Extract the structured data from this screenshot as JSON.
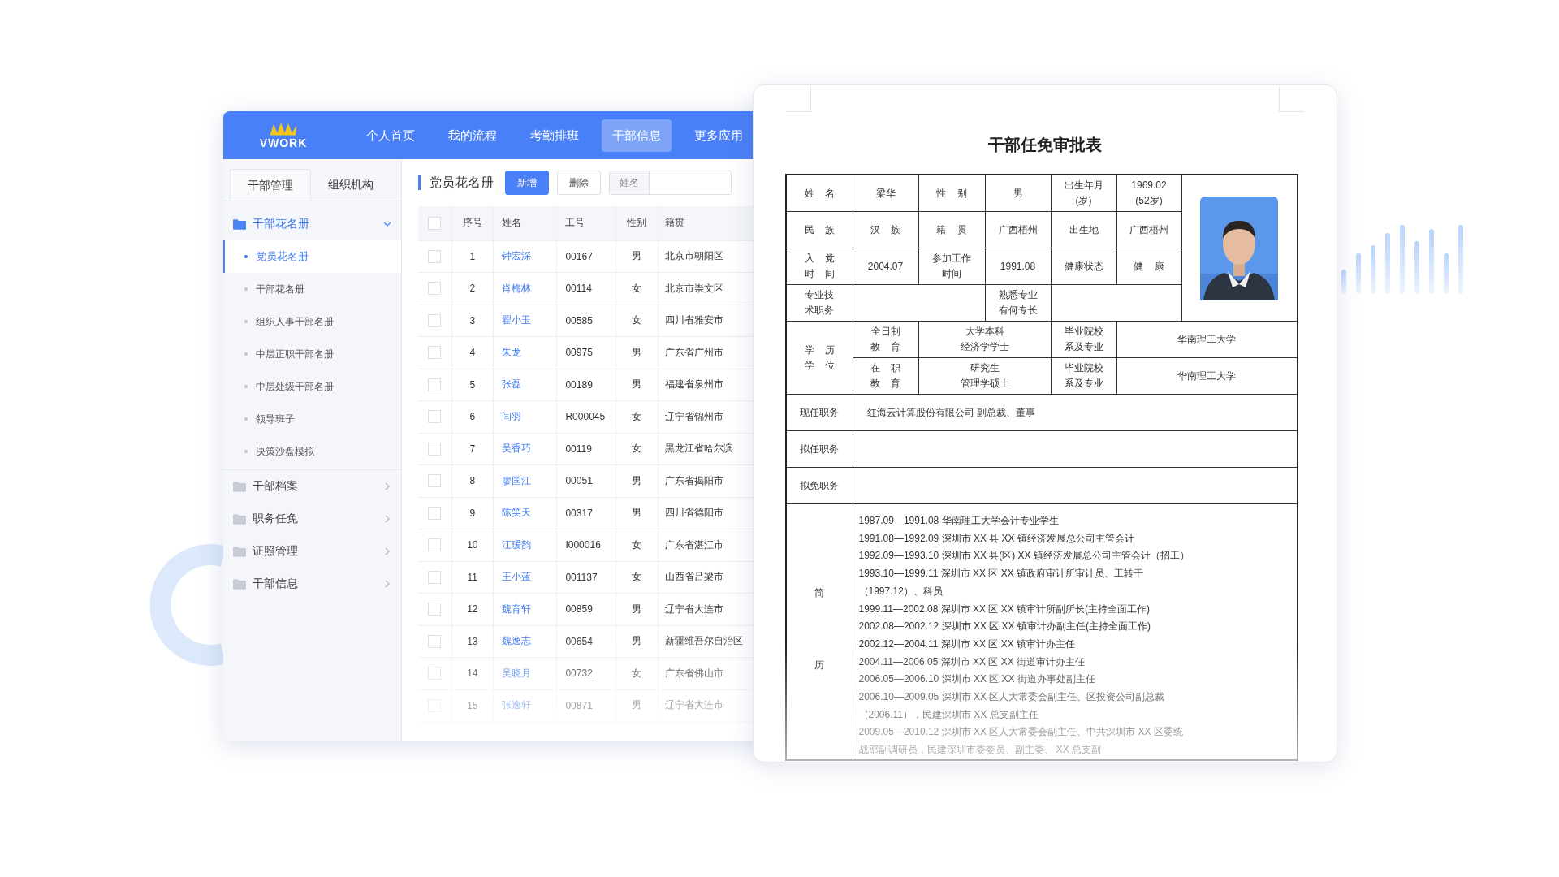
{
  "nav": {
    "logo": "VWORK",
    "items": [
      {
        "label": "个人首页",
        "selected": false
      },
      {
        "label": "我的流程",
        "selected": false
      },
      {
        "label": "考勤排班",
        "selected": false
      },
      {
        "label": "干部信息",
        "selected": true
      },
      {
        "label": "更多应用",
        "selected": false
      }
    ]
  },
  "sidebar": {
    "tabs": [
      {
        "label": "干部管理",
        "selected": true
      },
      {
        "label": "组织机构",
        "selected": false
      }
    ],
    "groups": [
      {
        "label": "干部花名册",
        "expanded": true,
        "children": [
          {
            "label": "党员花名册",
            "selected": true
          },
          {
            "label": "干部花名册",
            "selected": false
          },
          {
            "label": "组织人事干部名册",
            "selected": false
          },
          {
            "label": "中层正职干部名册",
            "selected": false
          },
          {
            "label": "中层处级干部名册",
            "selected": false
          },
          {
            "label": "领导班子",
            "selected": false
          },
          {
            "label": "决策沙盘模拟",
            "selected": false
          }
        ]
      },
      {
        "label": "干部档案",
        "expanded": false
      },
      {
        "label": "职务任免",
        "expanded": false
      },
      {
        "label": "证照管理",
        "expanded": false
      },
      {
        "label": "干部信息",
        "expanded": false
      }
    ]
  },
  "roster": {
    "title": "党员花名册",
    "buttons": [
      {
        "label": "新增",
        "kind": "primary"
      },
      {
        "label": "删除",
        "kind": "default"
      }
    ],
    "search": {
      "label": "姓名"
    },
    "all_checked": false,
    "columns": [
      "序号",
      "姓名",
      "工号",
      "性别",
      "籍贯"
    ],
    "rows": [
      {
        "checked": false,
        "cells": [
          "1",
          "钟宏深",
          "00167",
          "男",
          "北京市朝阳区"
        ]
      },
      {
        "checked": false,
        "cells": [
          "2",
          "肖梅林",
          "00114",
          "女",
          "北京市崇文区"
        ]
      },
      {
        "checked": false,
        "cells": [
          "3",
          "翟小玉",
          "00585",
          "女",
          "四川省雅安市"
        ]
      },
      {
        "checked": false,
        "cells": [
          "4",
          "朱龙",
          "00975",
          "男",
          "广东省广州市"
        ]
      },
      {
        "checked": false,
        "cells": [
          "5",
          "张磊",
          "00189",
          "男",
          "福建省泉州市"
        ]
      },
      {
        "checked": false,
        "cells": [
          "6",
          "闫羽",
          "R000045",
          "女",
          "辽宁省锦州市"
        ]
      },
      {
        "checked": false,
        "cells": [
          "7",
          "吴香巧",
          "00119",
          "女",
          "黑龙江省哈尔滨"
        ]
      },
      {
        "checked": false,
        "cells": [
          "8",
          "廖国江",
          "00051",
          "男",
          "广东省揭阳市"
        ]
      },
      {
        "checked": false,
        "cells": [
          "9",
          "陈笑天",
          "00317",
          "男",
          "四川省德阳市"
        ]
      },
      {
        "checked": false,
        "cells": [
          "10",
          "江瑗韵",
          "I000016",
          "女",
          "广东省湛江市"
        ]
      },
      {
        "checked": false,
        "cells": [
          "11",
          "王小蓝",
          "001137",
          "女",
          "山西省吕梁市"
        ]
      },
      {
        "checked": false,
        "cells": [
          "12",
          "魏育轩",
          "00859",
          "男",
          "辽宁省大连市"
        ]
      },
      {
        "checked": false,
        "cells": [
          "13",
          "魏逸志",
          "00654",
          "男",
          "新疆维吾尔自治区"
        ]
      },
      {
        "checked": false,
        "cells": [
          "14",
          "吴晓月",
          "00732",
          "女",
          "广东省佛山市"
        ]
      },
      {
        "checked": false,
        "cells": [
          "15",
          "张逸轩",
          "00871",
          "男",
          "辽宁省大连市"
        ]
      }
    ]
  },
  "form": {
    "title": "干部任免审批表",
    "info_rows": [
      {
        "kind": "full",
        "cells": [
          [
            "姓 名"
          ],
          [
            "梁华"
          ],
          [
            "性 别"
          ],
          [
            "男"
          ],
          [
            "出生年月",
            "(岁)"
          ],
          [
            "1969.02",
            "(52岁)"
          ]
        ]
      },
      {
        "kind": "full",
        "cells": [
          [
            "民 族"
          ],
          [
            "汉 族"
          ],
          [
            "籍 贯"
          ],
          [
            "广西梧州"
          ],
          [
            "出生地"
          ],
          [
            "广西梧州"
          ]
        ]
      },
      {
        "kind": "full",
        "cells": [
          [
            "入 党",
            "时 间"
          ],
          [
            "2004.07"
          ],
          [
            "参加工作",
            "时间"
          ],
          [
            "1991.08"
          ],
          [
            "健康状态"
          ],
          [
            "健 康"
          ]
        ]
      },
      {
        "kind": "pairs",
        "cells": [
          [
            "专业技",
            "术职务"
          ],
          [
            "熟悉专业",
            "有何专长"
          ]
        ]
      }
    ],
    "education": {
      "label": [
        "学 历",
        "学 位"
      ],
      "rows": [
        {
          "cells": [
            [
              "全日制",
              "教 育"
            ],
            [
              "大学本科",
              "经济学学士"
            ],
            [
              "毕业院校",
              "系及专业"
            ],
            [
              "华南理工大学"
            ]
          ]
        },
        {
          "cells": [
            [
              "在 职",
              "教 育"
            ],
            [
              "研究生",
              "管理学硕士"
            ],
            [
              "毕业院校",
              "系及专业"
            ],
            [
              "华南理工大学"
            ]
          ]
        }
      ]
    },
    "posts": [
      {
        "label": "现任职务",
        "value": "红海云计算股份有限公司 副总裁、董事"
      },
      {
        "label": "拟任职务"
      },
      {
        "label": "拟免职务"
      }
    ],
    "resume": {
      "label_chars": [
        "简",
        "历"
      ],
      "lines": [
        "1987.09—1991.08 华南理工大学会计专业学生",
        "1991.08—1992.09 深圳市 XX 县 XX 镇经济发展总公司主管会计",
        "1992.09—1993.10 深圳市 XX 县(区) XX 镇经济发展总公司主管会计（招工）",
        "1993.10—1999.11 深圳市 XX 区 XX 镇政府审计所审计员、工转干",
        "（1997.12）、科员",
        "1999.11—2002.08 深圳市 XX 区 XX 镇审计所副所长(主持全面工作)",
        "2002.08—2002.12 深圳市 XX 区 XX 镇审计办副主任(主持全面工作)",
        "2002.12—2004.11 深圳市 XX 区 XX 镇审计办主任",
        "2004.11—2006.05 深圳市 XX 区 XX 街道审计办主任",
        "2006.05—2006.10 深圳市 XX 区 XX 街道办事处副主任",
        "2006.10—2009.05 深圳市 XX 区人大常委会副主任、区投资公司副总裁",
        "（2006.11），民建深圳市 XX 总支副主任",
        "2009.05—2010.12 深圳市 XX 区人大常委会副主任、中共深圳市 XX 区委统",
        "战部副调研员，民建深圳市委委员、副主委、 XX 总支副"
      ]
    }
  }
}
